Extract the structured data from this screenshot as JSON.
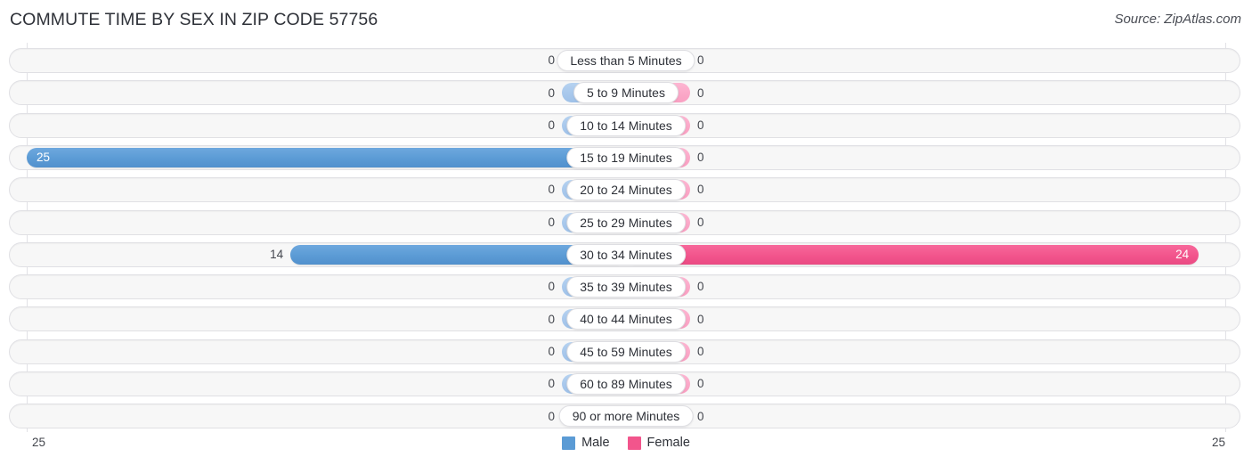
{
  "header": {
    "title": "COMMUTE TIME BY SEX IN ZIP CODE 57756",
    "source": "Source: ZipAtlas.com"
  },
  "axis": {
    "left_max_label": "25",
    "right_max_label": "25"
  },
  "legend": {
    "items": [
      {
        "label": "Male",
        "color": "#5b9bd5"
      },
      {
        "label": "Female",
        "color": "#f2558c"
      }
    ]
  },
  "colors": {
    "male_filled": "#5b9bd5",
    "female_filled": "#f2558c",
    "male_stub": "#a8c8ec",
    "female_stub": "#fba8c8",
    "track_fill": "#f7f7f7",
    "track_border": "#e0e0e4",
    "text": "#2e3138"
  },
  "chart_data": {
    "type": "bar",
    "subtype": "diverging-horizontal",
    "title": "COMMUTE TIME BY SEX IN ZIP CODE 57756",
    "xlabel": "",
    "ylabel": "",
    "xlim": [
      25,
      0,
      25
    ],
    "grid": true,
    "legend_position": "bottom-center",
    "categories": [
      "Less than 5 Minutes",
      "5 to 9 Minutes",
      "10 to 14 Minutes",
      "15 to 19 Minutes",
      "20 to 24 Minutes",
      "25 to 29 Minutes",
      "30 to 34 Minutes",
      "35 to 39 Minutes",
      "40 to 44 Minutes",
      "45 to 59 Minutes",
      "60 to 89 Minutes",
      "90 or more Minutes"
    ],
    "series": [
      {
        "name": "Male",
        "direction": "left",
        "color": "#5b9bd5",
        "values": [
          0,
          0,
          0,
          25,
          0,
          0,
          14,
          0,
          0,
          0,
          0,
          0
        ],
        "labels": [
          "0",
          "0",
          "0",
          "25",
          "0",
          "0",
          "14",
          "0",
          "0",
          "0",
          "0",
          "0"
        ]
      },
      {
        "name": "Female",
        "direction": "right",
        "color": "#f2558c",
        "values": [
          0,
          0,
          0,
          0,
          0,
          0,
          24,
          0,
          0,
          0,
          0,
          0
        ],
        "labels": [
          "0",
          "0",
          "0",
          "0",
          "0",
          "0",
          "24",
          "0",
          "0",
          "0",
          "0",
          "0"
        ]
      }
    ]
  }
}
